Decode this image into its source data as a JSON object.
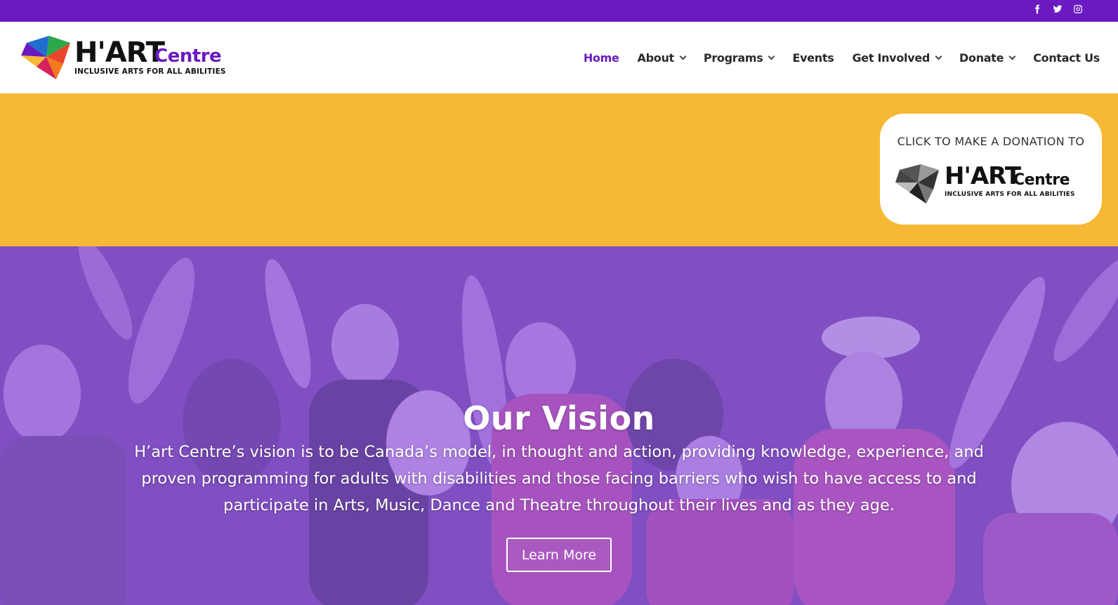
{
  "social": {
    "facebook_icon": "facebook-icon",
    "twitter_icon": "twitter-icon",
    "instagram_icon": "instagram-icon"
  },
  "brand": {
    "word": "H'ART",
    "centre": "Centre",
    "tagline": "INCLUSIVE ARTS FOR ALL ABILITIES",
    "purple": "#6a1ac0",
    "yellow": "#f6b935"
  },
  "nav": {
    "items": [
      {
        "label": "Home",
        "active": true,
        "dropdown": false
      },
      {
        "label": "About",
        "active": false,
        "dropdown": true
      },
      {
        "label": "Programs",
        "active": false,
        "dropdown": true
      },
      {
        "label": "Events",
        "active": false,
        "dropdown": false
      },
      {
        "label": "Get Involved",
        "active": false,
        "dropdown": true
      },
      {
        "label": "Donate",
        "active": false,
        "dropdown": true
      },
      {
        "label": "Contact Us",
        "active": false,
        "dropdown": false
      }
    ]
  },
  "donate_card": {
    "title": "CLICK TO MAKE A DONATION TO",
    "word": "H'ART",
    "centre": "Centre",
    "tagline": "INCLUSIVE ARTS FOR ALL ABILITIES"
  },
  "hero": {
    "title": "Our Vision",
    "text": "H’art Centre’s vision is to be Canada’s model, in thought and action, providing knowledge, experience, and proven programming for adults with disabilities and those facing barriers who wish to have access to and participate in Arts, Music, Dance and Theatre throughout their lives and as they age.",
    "button_label": "Learn More"
  }
}
